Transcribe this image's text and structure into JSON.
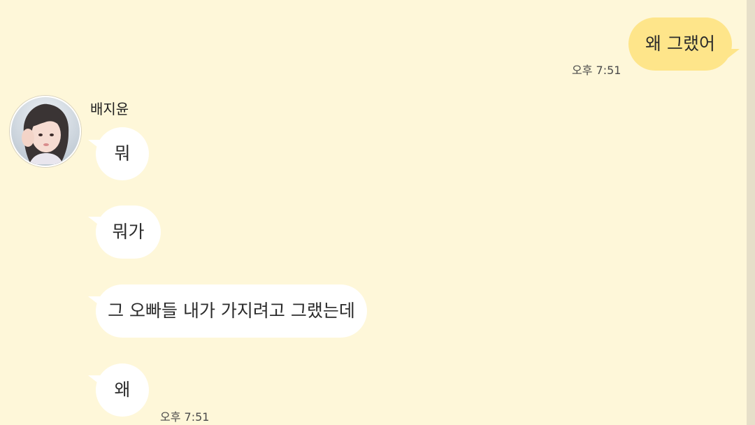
{
  "chat": {
    "outgoing": [
      {
        "text": "왜 그랬어",
        "time": "오후 7:51"
      }
    ],
    "contact": {
      "name": "배지윤",
      "avatar_icon": "profile-photo"
    },
    "incoming": [
      {
        "text": "뭐"
      },
      {
        "text": "뭐가"
      },
      {
        "text": "그 오빠들 내가 가지려고 그랬는데"
      },
      {
        "text": "왜",
        "time": "오후 7:51"
      }
    ]
  },
  "colors": {
    "background": "#FEF7D9",
    "sent_bubble": "#FEE58A",
    "received_bubble": "#FFFFFF"
  }
}
